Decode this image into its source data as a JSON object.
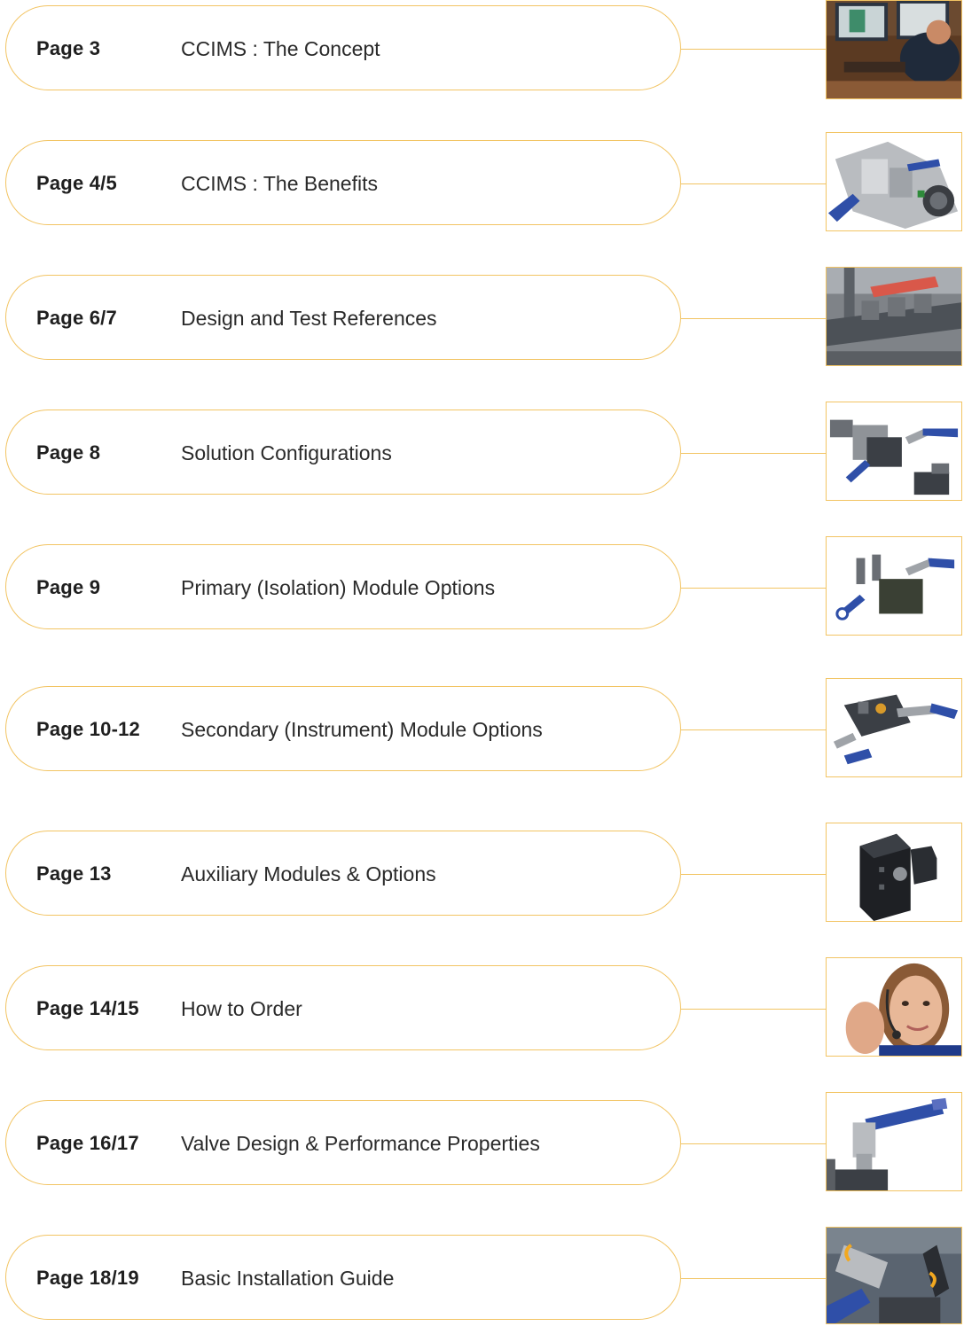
{
  "colors": {
    "accent_border": "#f2c463",
    "label_text": "#1f1f1f",
    "title_text": "#2a2a2a"
  },
  "contents": [
    {
      "page": "Page 3",
      "title": "CCIMS : The Concept",
      "image": "engineer-at-computer-photo"
    },
    {
      "page": "Page 4/5",
      "title": "CCIMS : The Benefits",
      "image": "valve-assembly-photo"
    },
    {
      "page": "Page 6/7",
      "title": "Design and Test References",
      "image": "test-rig-photo"
    },
    {
      "page": "Page 8",
      "title": "Solution Configurations",
      "image": "valve-configuration-photo"
    },
    {
      "page": "Page 9",
      "title": "Primary (Isolation) Module Options",
      "image": "isolation-module-photo"
    },
    {
      "page": "Page 10-12",
      "title": "Secondary (Instrument) Module Options",
      "image": "instrument-module-photo"
    },
    {
      "page": "Page 13",
      "title": "Auxiliary Modules & Options",
      "image": "auxiliary-module-photo"
    },
    {
      "page": "Page 14/15",
      "title": "How to Order",
      "image": "customer-service-agent-photo"
    },
    {
      "page": "Page 16/17",
      "title": "Valve Design & Performance Properties",
      "image": "valve-handle-photo"
    },
    {
      "page": "Page 18/19",
      "title": "Basic Installation Guide",
      "image": "installation-guide-photo"
    }
  ]
}
